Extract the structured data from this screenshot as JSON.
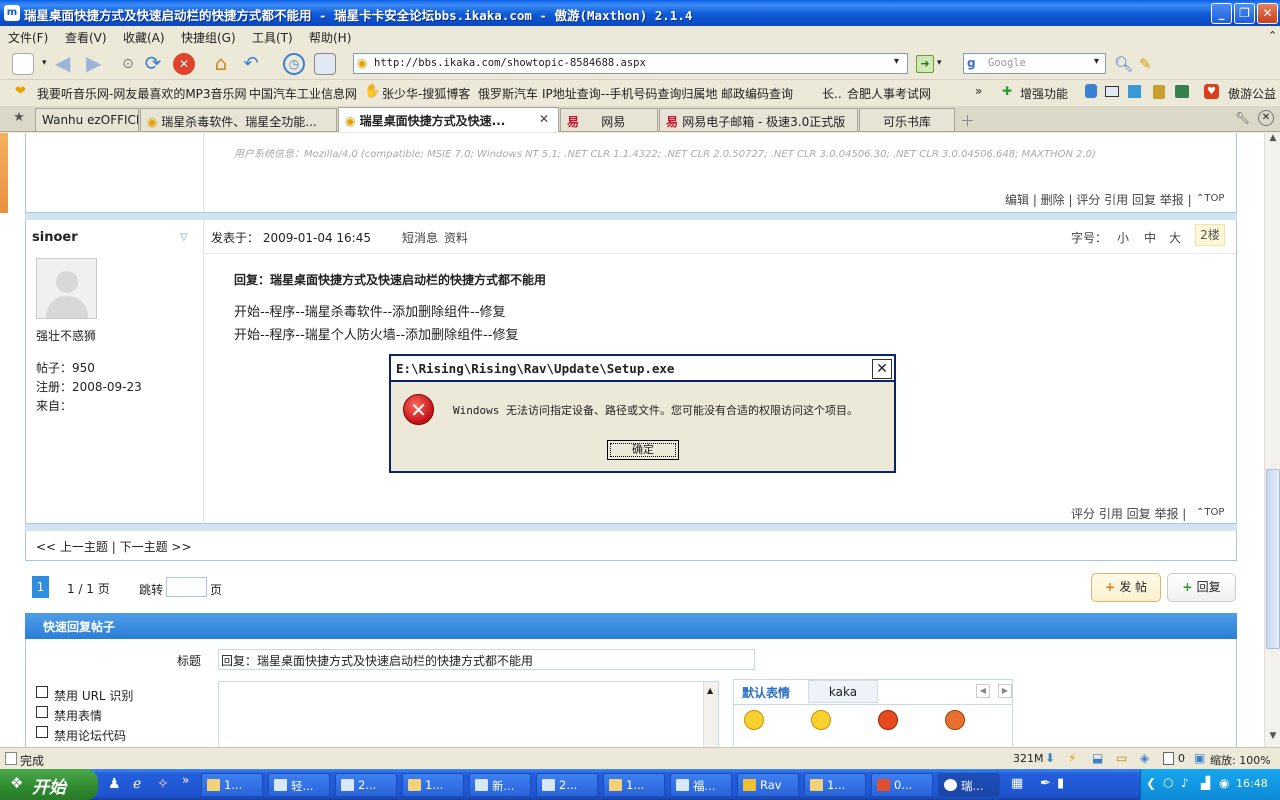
{
  "window": {
    "title": "瑞星桌面快捷方式及快速启动栏的快捷方式都不能用 - 瑞星卡卡安全论坛bbs.ikaka.com - 傲游(Maxthon) 2.1.4"
  },
  "menu": [
    "文件(F)",
    "查看(V)",
    "收藏(A)",
    "快捷组(G)",
    "工具(T)",
    "帮助(H)"
  ],
  "toolbar": {
    "address": "http://bbs.ikaka.com/showtopic-8584688.aspx",
    "search_placeholder": "Google"
  },
  "favorites": [
    "我要听音乐网-网友最喜欢的MP3音乐网",
    "中国汽车工业信息网",
    "张少华-搜狐博客",
    "俄罗斯汽车",
    "IP地址查询--手机号码查询归属地",
    "邮政编码查询",
    "长..",
    "合肥人事考试网",
    "增强功能",
    "傲游公益"
  ],
  "tabs": [
    {
      "label": "Wanhu ezOFFICE",
      "active": false
    },
    {
      "label": "瑞星杀毒软件、瑞星全功能...",
      "active": false
    },
    {
      "label": "瑞星桌面快捷方式及快速...",
      "active": true
    },
    {
      "label": "网易",
      "active": false
    },
    {
      "label": "网易电子邮箱 - 极速3.0正式版",
      "active": false
    },
    {
      "label": "可乐书库",
      "active": false
    }
  ],
  "prev_post": {
    "user_agent": "用户系统信息：Mozilla/4.0 (compatible; MSIE 7.0; Windows NT 5.1; .NET CLR 1.1.4322; .NET CLR 2.0.50727; .NET CLR 3.0.04506.30; .NET CLR 3.0.04506.648; MAXTHON 2.0)",
    "actions": "编辑 | 删除 | 评分  引用  回复  举报 |",
    "top": "TOP"
  },
  "post": {
    "username": "sinoer",
    "posted_label": "发表于：",
    "posted_time": "2009-01-04 16:45",
    "pm_link": "短消息",
    "profile_link": "资料",
    "font_label": "字号：",
    "font_small": "小",
    "font_medium": "中",
    "font_large": "大",
    "floor": "2楼",
    "user_title": "强壮不惑狮",
    "posts_label": "帖子：",
    "posts_value": "950",
    "reg_label": "注册：",
    "reg_value": "2008-09-23",
    "from_label": "来自：",
    "reply_title": "回复：瑞星桌面快捷方式及快速启动栏的快捷方式都不能用",
    "line1": "开始--程序--瑞星杀毒软件--添加删除组件--修复",
    "line2": "开始--程序--瑞星个人防火墙--添加删除组件--修复",
    "actions": "评分  引用  回复  举报 |",
    "top": "TOP"
  },
  "nav": {
    "prev_next": "<< 上一主题 | 下一主题 >>",
    "page_current": "1",
    "page_info": "1 / 1 页",
    "jump_label": "跳转",
    "jump_unit": "页",
    "new_topic": "发 帖",
    "reply": "回复"
  },
  "quick_reply": {
    "header": "快速回复帖子",
    "title_label": "标题",
    "title_value": "回复：瑞星桌面快捷方式及快速启动栏的快捷方式都不能用",
    "opt1": "禁用 URL 识别",
    "opt2": "禁用表情",
    "opt3": "禁用论坛代码",
    "emote_tab1": "默认表情",
    "emote_tab2": "kaka"
  },
  "dialog": {
    "title": "E:\\Rising\\Rising\\Rav\\Update\\Setup.exe",
    "message": "Windows 无法访问指定设备、路径或文件。您可能没有合适的权限访问这个项目。",
    "ok": "确定"
  },
  "statusbar": {
    "text": "完成",
    "memory": "321M",
    "zoom": "缩放: 100%",
    "count": "0"
  },
  "taskbar": {
    "start": "开始",
    "buttons": [
      "1...",
      "轻...",
      "2...",
      "1...",
      "新...",
      "2...",
      "1...",
      "福...",
      "Rav",
      "1...",
      "0...",
      "瑞..."
    ],
    "clock": "16:48"
  },
  "colors": {
    "title_blue": "#0a5ee8",
    "forum_header": "#2a7ed6",
    "taskbar_blue": "#245edb",
    "start_green": "#2f8a2f"
  }
}
